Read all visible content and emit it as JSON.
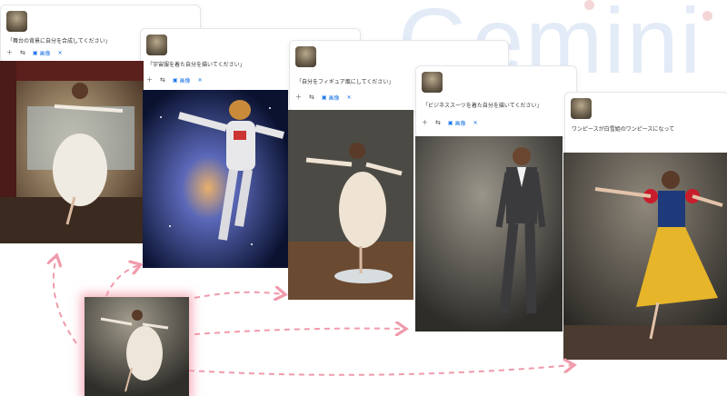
{
  "brand": {
    "watermark": "Gemini"
  },
  "colors": {
    "arrow": "#f09aab",
    "link": "#1a73e8",
    "card_border": "#e4e6ea"
  },
  "toolbar_icons": [
    "plus-icon",
    "tune-icon",
    "image-chip-icon",
    "close-icon"
  ],
  "cards": [
    {
      "prompt": "「舞台の背景に自分を合成してください」",
      "chip_label": "画像"
    },
    {
      "prompt": "「宇宙服を着た自分を描いてください」",
      "chip_label": "画像"
    },
    {
      "prompt": "「自分をフィギュア風にしてください」",
      "chip_label": "画像"
    },
    {
      "prompt": "「ビジネススーツを着た自分を描いてください」",
      "chip_label": "画像"
    },
    {
      "prompt": "ワンピースが白雪姫のワンピースになって",
      "chip_label": "画像"
    }
  ]
}
